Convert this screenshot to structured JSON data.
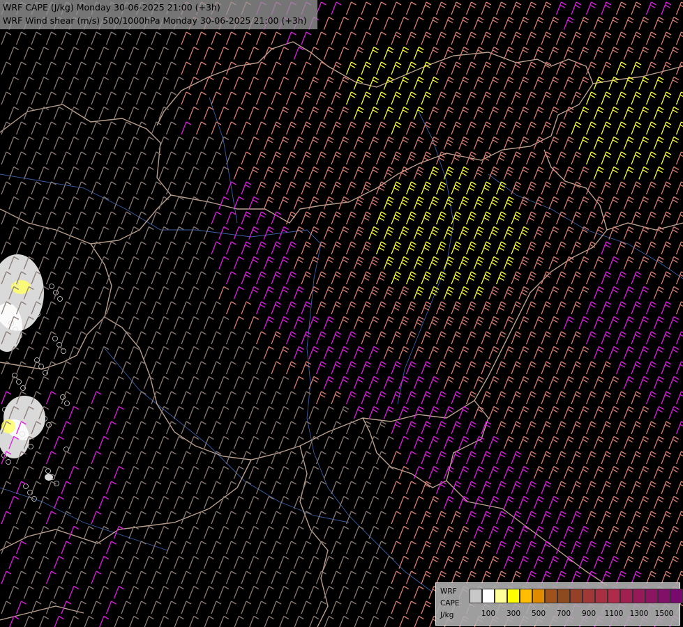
{
  "title": {
    "line1": "WRF CAPE (J/kg) Monday 30-06-2025 21:00 (+3h)",
    "line2": "WRF Wind shear (m/s) 500/1000hPa Monday 30-06-2025 21:00 (+3h)"
  },
  "legend": {
    "label_line1": "WRF",
    "label_line2": "CAPE",
    "label_line3": "J/kg",
    "swatch_colors": [
      "#c8c8c8",
      "#ffffff",
      "#ffff99",
      "#ffff00",
      "#ffbf00",
      "#e08a00",
      "#a0521d",
      "#8c4a1e",
      "#96402a",
      "#a03838",
      "#a83040",
      "#b02a4a",
      "#a02050",
      "#961a58",
      "#8c1460",
      "#821068",
      "#780a6e"
    ],
    "ticks": [
      "100",
      "300",
      "500",
      "700",
      "900",
      "1100",
      "1300",
      "1500"
    ]
  },
  "colors": {
    "background": "#000000",
    "barb_gray": "#8a7a74",
    "barb_salmon": "#d77f73",
    "barb_magenta": "#dd1fe0",
    "barb_yellow": "#ffff33",
    "border_line": "#e8c7b0",
    "river_line": "#3a5fa8"
  }
}
